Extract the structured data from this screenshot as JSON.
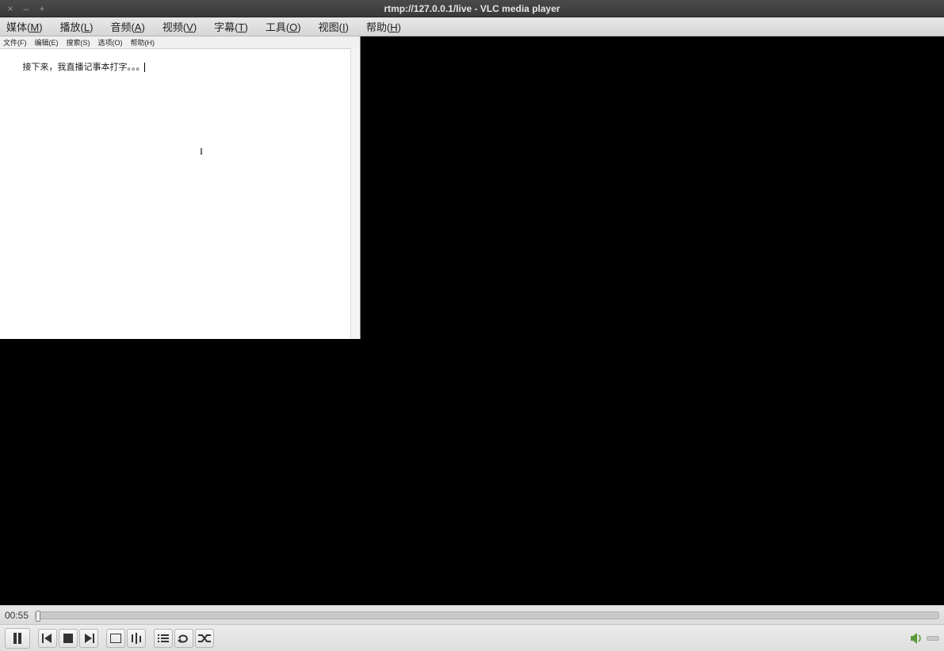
{
  "window": {
    "title": "rtmp://127.0.0.1/live - VLC media player",
    "close_glyph": "×",
    "min_glyph": "–",
    "max_glyph": "+"
  },
  "vlc_menu": {
    "items": [
      {
        "label_pre": "媒体(",
        "hot": "M",
        "label_post": ")"
      },
      {
        "label_pre": "播放(",
        "hot": "L",
        "label_post": ")"
      },
      {
        "label_pre": "音频(",
        "hot": "A",
        "label_post": ")"
      },
      {
        "label_pre": "视频(",
        "hot": "V",
        "label_post": ")"
      },
      {
        "label_pre": "字幕(",
        "hot": "T",
        "label_post": ")"
      },
      {
        "label_pre": "工具(",
        "hot": "O",
        "label_post": ")"
      },
      {
        "label_pre": "视图(",
        "hot": "I",
        "label_post": ")"
      },
      {
        "label_pre": "帮助(",
        "hot": "H",
        "label_post": ")"
      }
    ]
  },
  "notepad": {
    "menu": [
      "文件(F)",
      "编辑(E)",
      "搜索(S)",
      "选项(O)",
      "帮助(H)"
    ],
    "text": "接下来，我直播记事本打字。。。"
  },
  "player": {
    "elapsed": "00:55"
  }
}
